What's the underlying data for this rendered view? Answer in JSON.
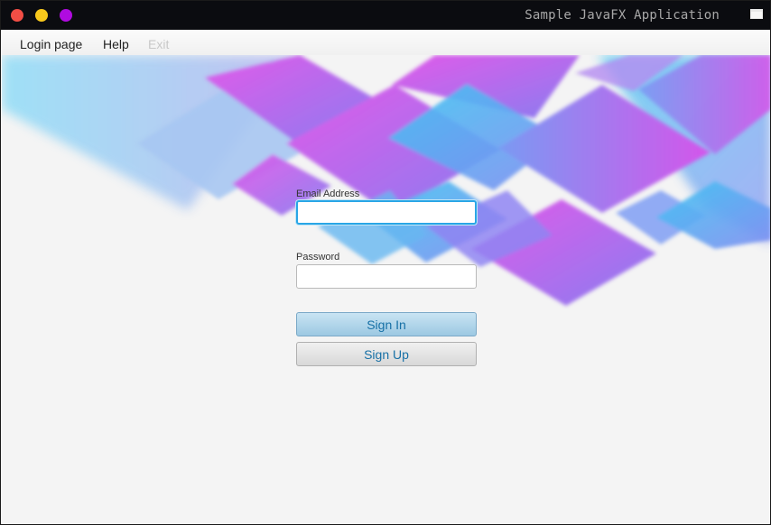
{
  "window": {
    "title": "Sample JavaFX Application"
  },
  "menu": {
    "login": "Login page",
    "help": "Help",
    "exit": "Exit"
  },
  "form": {
    "email_label": "Email Address",
    "email_value": "",
    "password_label": "Password",
    "password_value": "",
    "signin_label": "Sign In",
    "signup_label": "Sign Up"
  },
  "colors": {
    "accent": "#29a6e6",
    "button_text": "#1770a6",
    "banner_pink": "#d64fe8",
    "banner_cyan": "#3cc8f0"
  }
}
